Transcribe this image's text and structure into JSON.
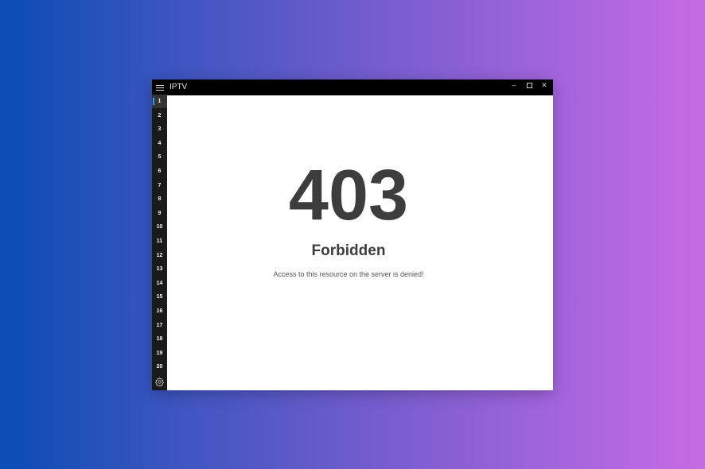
{
  "window": {
    "title": "IPTV",
    "controls": {
      "minimize": "–",
      "maximize": "",
      "close": "✕"
    }
  },
  "sidebar": {
    "channels": [
      "1",
      "2",
      "3",
      "4",
      "5",
      "6",
      "7",
      "8",
      "9",
      "10",
      "11",
      "12",
      "13",
      "14",
      "15",
      "16",
      "17",
      "18",
      "19",
      "20"
    ],
    "active_index": 0,
    "menu_icon": "hamburger-icon",
    "settings_icon": "gear-icon"
  },
  "error": {
    "code": "403",
    "title": "Forbidden",
    "message": "Access to this resource on the server is denied!"
  },
  "colors": {
    "titlebar": "#000000",
    "sidebar": "#1a1a1a",
    "accent": "#3a9bf0",
    "text_dark": "#3d3d3d"
  }
}
